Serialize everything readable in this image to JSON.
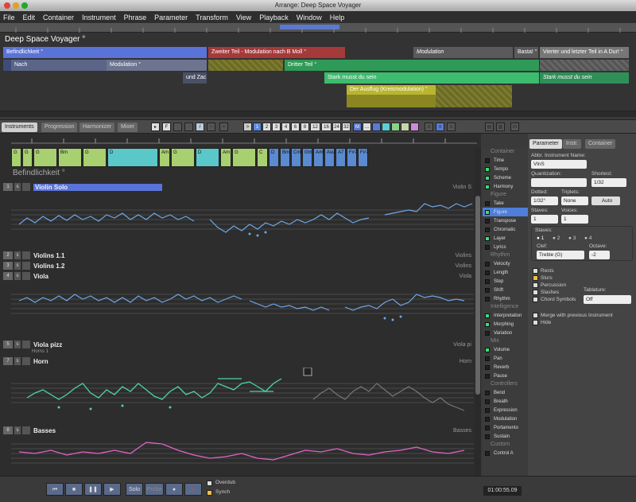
{
  "window_title": "Arrange: Deep Space Voyager",
  "menu": [
    "File",
    "Edit",
    "Container",
    "Instrument",
    "Phrase",
    "Parameter",
    "Transform",
    "View",
    "Playback",
    "Window",
    "Help"
  ],
  "arrange": {
    "title": "Deep Space Voyager °",
    "blocks": [
      "Befindlichkeit °",
      "Zweiter Teil - Modulation nach B Moll °",
      "Modulation",
      "Basta! °",
      "Vierter und letzter Teil in A Dur! °",
      "Nach",
      "Modulation °",
      "und Zac",
      "Dritter Teil °",
      "Stark musst du sein",
      "Stark musst du sein",
      "Der Ausflug (Kreismodulation) °"
    ]
  },
  "tabs": [
    "Instruments",
    "Progression",
    "Harmonizer",
    "Mixer"
  ],
  "toolbar_nums": [
    ">",
    "1",
    "2",
    "3",
    "4",
    "6",
    "8",
    "12",
    "16",
    "24",
    "32",
    "M",
    "..."
  ],
  "section_title": "Befindlichkeit °",
  "chords": [
    "G",
    "G",
    "G",
    "Bm",
    "G",
    "D",
    "Am",
    "G",
    "D",
    "Am",
    "G",
    "C",
    "D",
    "Bm",
    "C#m",
    "Gm",
    "A#m",
    "Asu",
    "A7",
    "F#7",
    "F#7"
  ],
  "tracks": [
    {
      "num": "1",
      "name": "Violin Solo",
      "right": "Violin S"
    },
    {
      "num": "2",
      "name": "Violins 1.1",
      "right": "Violins"
    },
    {
      "num": "3",
      "name": "Violins 1.2",
      "right": "Violins"
    },
    {
      "num": "4",
      "name": "Viola",
      "right": "Viola"
    },
    {
      "num": "5",
      "name": "Viola pizz",
      "right": "Viola pi"
    },
    {
      "num": "7",
      "name": "Horn",
      "right": "Horn"
    },
    {
      "num": "8",
      "name": "Basses",
      "right": "Basses"
    }
  ],
  "track_sublabel": "Horns 1",
  "sidelist": [
    {
      "type": "head",
      "label": "Container"
    },
    {
      "label": "Time",
      "on": false
    },
    {
      "label": "Tempo",
      "on": true
    },
    {
      "label": "Scheme",
      "on": true
    },
    {
      "label": "Harmony",
      "on": true
    },
    {
      "type": "head",
      "label": "Figure"
    },
    {
      "label": "Take",
      "on": false
    },
    {
      "label": "Figure",
      "on": true,
      "sel": true
    },
    {
      "label": "Transpose",
      "on": false
    },
    {
      "label": "Chromatic",
      "on": false
    },
    {
      "label": "Layer",
      "on": true
    },
    {
      "label": "Lyrics",
      "on": false
    },
    {
      "type": "head",
      "label": "Rhythm"
    },
    {
      "label": "Velocity",
      "on": false
    },
    {
      "label": "Length",
      "on": false
    },
    {
      "label": "Step",
      "on": false
    },
    {
      "label": "Shift",
      "on": false
    },
    {
      "label": "Rhythm",
      "on": false
    },
    {
      "type": "head",
      "label": "Intelligence"
    },
    {
      "label": "Interpretation",
      "on": true
    },
    {
      "label": "Morphing",
      "on": true
    },
    {
      "label": "Variation",
      "on": false
    },
    {
      "type": "head",
      "label": "Mix"
    },
    {
      "label": "Volume",
      "on": true
    },
    {
      "label": "Pan",
      "on": false
    },
    {
      "label": "Reverb",
      "on": false
    },
    {
      "label": "Pause",
      "on": false
    },
    {
      "type": "head",
      "label": "Controllers"
    },
    {
      "label": "Bend",
      "on": false
    },
    {
      "label": "Breath",
      "on": false
    },
    {
      "label": "Expression",
      "on": false
    },
    {
      "label": "Modulation",
      "on": false
    },
    {
      "label": "Portamento",
      "on": false
    },
    {
      "label": "Sustain",
      "on": false
    },
    {
      "type": "head",
      "label": "Custom"
    },
    {
      "label": "Control A",
      "on": false
    }
  ],
  "panel": {
    "tabs": [
      "Parameter",
      "Instr.",
      "Container"
    ],
    "abbr_label": "Abbr. Instrument Name:",
    "abbr_value": "VlnS",
    "quantization_label": "Quantization:",
    "shortest_label": "Shortest:",
    "shortest_value": "1/32",
    "dotted_label": "Dotted:",
    "dotted_value": "1/32°",
    "triplets_label": "Triplets:",
    "triplets_value": "None",
    "auto_label": "Auto",
    "staves_label": "Staves:",
    "staves_value": "1",
    "voices_label": "Voices:",
    "voices_value": "1",
    "staves2_label": "Staves:",
    "staff_radios": [
      "1",
      "2",
      "3",
      "4"
    ],
    "clef_label": "Clef:",
    "clef_value": "Treble (G)",
    "octave_label": "Octave:",
    "octave_value": "-2",
    "checks": [
      {
        "label": "Rests",
        "on": false
      },
      {
        "label": "Slurs",
        "on": true
      },
      {
        "label": "Percussion",
        "on": false
      },
      {
        "label": "Slashes",
        "on": false
      },
      {
        "label": "Chord Symbols",
        "on": false
      }
    ],
    "tablature_label": "Tablature:",
    "tablature_value": "Off",
    "merge_label": "Merge with previous Instrument",
    "hide_label": "Hide"
  },
  "transport": {
    "solo": "Solo",
    "probe": "Probe",
    "overdub": "Overdub",
    "synch": "Synch",
    "time": "01:00:55.09"
  }
}
